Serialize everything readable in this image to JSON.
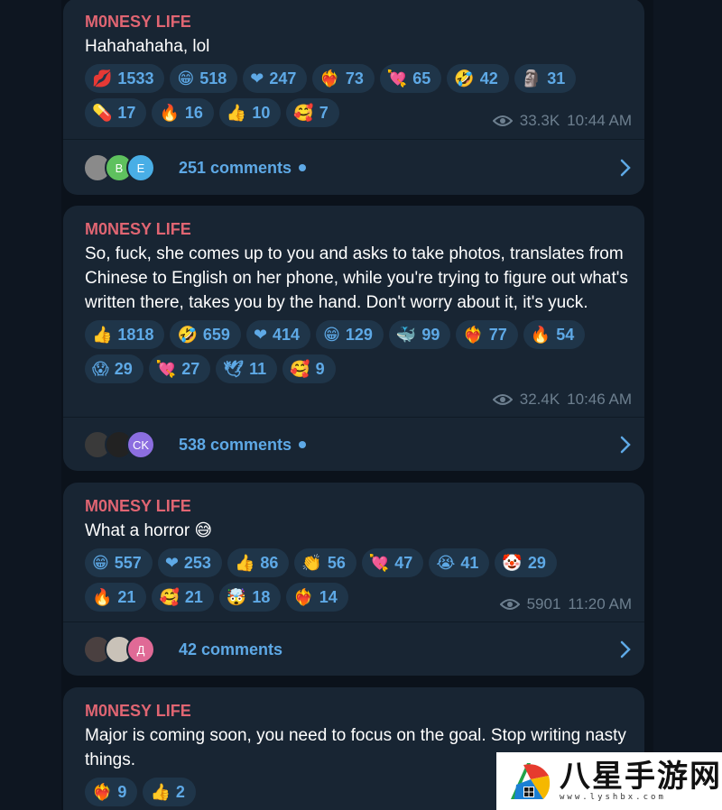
{
  "channel": "M0NESY LIFE",
  "posts": [
    {
      "text": "Hahahahaha, lol",
      "reactions": [
        {
          "emoji": "💋",
          "count": "1533"
        },
        {
          "emoji": "😁",
          "count": "518"
        },
        {
          "emoji": "❤",
          "count": "247"
        },
        {
          "emoji": "❤‍🔥",
          "count": "73"
        },
        {
          "emoji": "💘",
          "count": "65"
        },
        {
          "emoji": "🤣",
          "count": "42"
        },
        {
          "emoji": "🗿",
          "count": "31"
        },
        {
          "emoji": "💊",
          "count": "17"
        },
        {
          "emoji": "🔥",
          "count": "16"
        },
        {
          "emoji": "👍",
          "count": "10"
        },
        {
          "emoji": "🥰",
          "count": "7"
        }
      ],
      "views": "33.3K",
      "time": "10:44 AM",
      "comments": "251 comments",
      "avatars": [
        "",
        "B",
        "E"
      ]
    },
    {
      "text": "So, fuck, she comes up to you and asks to take photos, translates from Chinese to English on her phone, while you're trying to figure out what's written there, takes you by the hand. Don't worry about it, it's yuck.",
      "reactions": [
        {
          "emoji": "👍",
          "count": "1818"
        },
        {
          "emoji": "🤣",
          "count": "659"
        },
        {
          "emoji": "❤",
          "count": "414"
        },
        {
          "emoji": "😁",
          "count": "129"
        },
        {
          "emoji": "🐳",
          "count": "99"
        },
        {
          "emoji": "❤‍🔥",
          "count": "77"
        },
        {
          "emoji": "🔥",
          "count": "54"
        },
        {
          "emoji": "😱",
          "count": "29"
        },
        {
          "emoji": "💘",
          "count": "27"
        },
        {
          "emoji": "🕊",
          "count": "11"
        },
        {
          "emoji": "🥰",
          "count": "9"
        }
      ],
      "views": "32.4K",
      "time": "10:46 AM",
      "comments": "538 comments",
      "avatars": [
        "",
        "",
        "CK"
      ]
    },
    {
      "text": "What a horror 😅",
      "reactions": [
        {
          "emoji": "😁",
          "count": "557"
        },
        {
          "emoji": "❤",
          "count": "253"
        },
        {
          "emoji": "👍",
          "count": "86"
        },
        {
          "emoji": "👏",
          "count": "56"
        },
        {
          "emoji": "💘",
          "count": "47"
        },
        {
          "emoji": "😭",
          "count": "41"
        },
        {
          "emoji": "🤡",
          "count": "29"
        },
        {
          "emoji": "🔥",
          "count": "21"
        },
        {
          "emoji": "🥰",
          "count": "21"
        },
        {
          "emoji": "🤯",
          "count": "18"
        },
        {
          "emoji": "❤‍🔥",
          "count": "14"
        }
      ],
      "views": "5901",
      "time": "11:20 AM",
      "comments": "42 comments",
      "avatars": [
        "",
        "",
        "Д"
      ]
    },
    {
      "text": "Major is coming soon, you need to focus on the goal. Stop writing nasty things.",
      "reactions": [
        {
          "emoji": "❤‍🔥",
          "count": "9"
        },
        {
          "emoji": "👍",
          "count": "2"
        }
      ]
    }
  ],
  "watermark": {
    "title": "八星手游网",
    "url": "www.lyshbx.com"
  },
  "colors": {
    "author": "#e06572",
    "accent": "#5ea9e6",
    "bubble": "#182533",
    "background": "#0e1621"
  },
  "icons": {
    "views": "eye-icon",
    "open": "chevron-right-icon"
  }
}
